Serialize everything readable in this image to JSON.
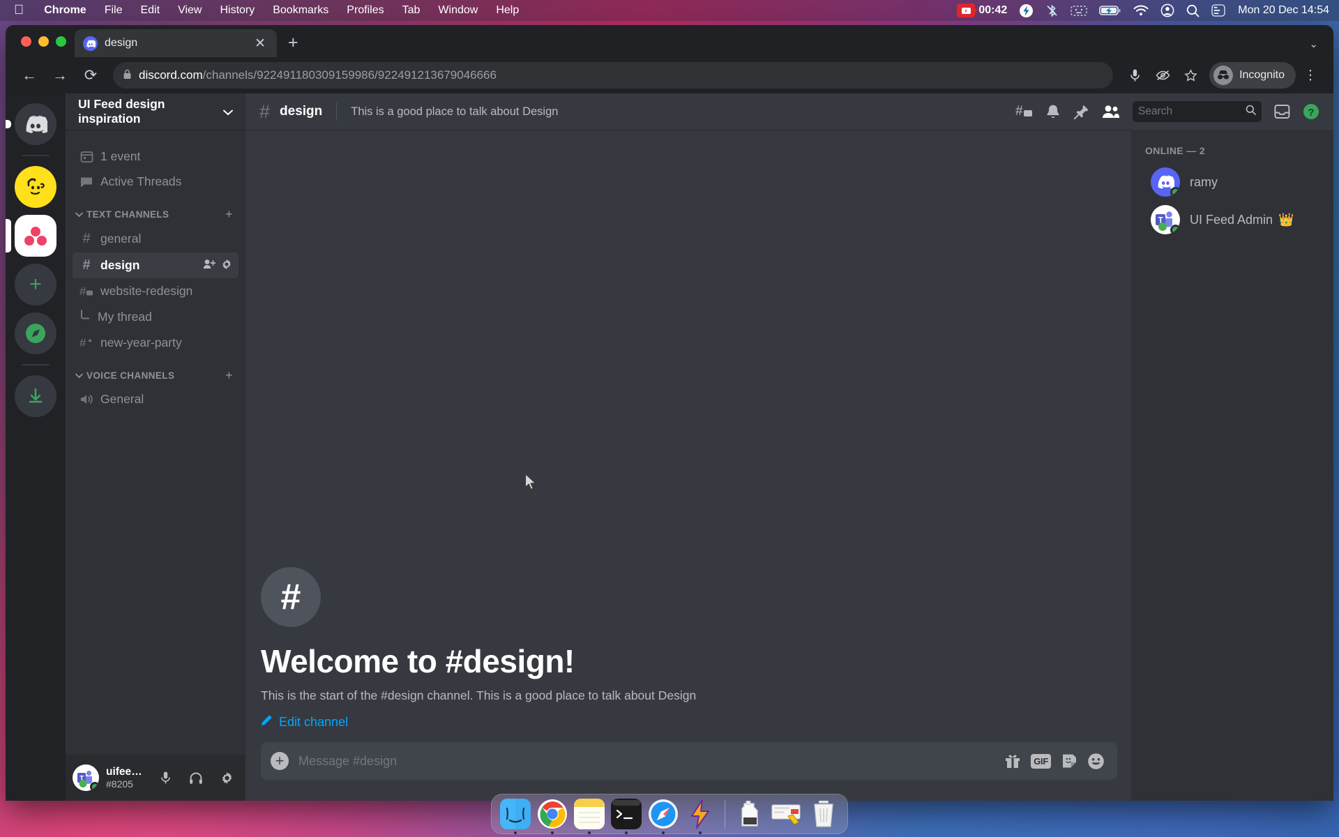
{
  "macos": {
    "menus": [
      "Chrome",
      "File",
      "Edit",
      "View",
      "History",
      "Bookmarks",
      "Profiles",
      "Tab",
      "Window",
      "Help"
    ],
    "app_name": "Chrome",
    "apple_logo": "apple-logo",
    "recording_time": "00:42",
    "clock": "Mon 20 Dec  14:54",
    "status_icons": [
      "lightning-icon",
      "bluetooth-off-icon",
      "keyboard-icon",
      "battery-charging-icon",
      "wifi-icon",
      "account-icon",
      "search-icon",
      "control-center-icon"
    ]
  },
  "browser": {
    "tab": {
      "title": "design",
      "favicon": "discord-icon",
      "close": "✕"
    },
    "new_tab": "+",
    "tab_list_chevron": "⌄",
    "nav": {
      "back": "←",
      "forward": "→",
      "reload": "⟳"
    },
    "url": {
      "lock": "🔒",
      "domain": "discord.com",
      "path": "/channels/922491180309159986/922491213679046666"
    },
    "omni_icons": [
      "microphone-icon",
      "eye-slash-icon",
      "bookmark-star-icon"
    ],
    "profile": {
      "label": "Incognito",
      "icon": "incognito-icon"
    },
    "menu": "⋮"
  },
  "discord": {
    "rail": [
      {
        "name": "discord-home",
        "type": "home"
      },
      {
        "name": "server-mailchimp",
        "type": "mailchimp"
      },
      {
        "name": "server-ui-feed",
        "type": "uifeed",
        "selected": true
      },
      {
        "name": "add-server",
        "type": "plus",
        "symbol": "+"
      },
      {
        "name": "explore-servers",
        "type": "compass"
      },
      {
        "name": "download-apps",
        "type": "download"
      }
    ],
    "guild": {
      "name": "UI Feed design inspiration",
      "chevron": "⌄"
    },
    "sidebar": {
      "top_items": [
        {
          "label": "1 event",
          "icon": "calendar-icon"
        },
        {
          "label": "Active Threads",
          "icon": "threads-icon"
        }
      ],
      "categories": [
        {
          "label": "Text Channels",
          "collapse": "⌄",
          "add": "+",
          "channels": [
            {
              "label": "general",
              "icon": "hash-icon",
              "active": false,
              "thread": false
            },
            {
              "label": "design",
              "icon": "hash-icon",
              "active": true,
              "thread": false,
              "tools": [
                "invite-icon",
                "settings-icon"
              ]
            },
            {
              "label": "website-redesign",
              "icon": "hash-thread-icon",
              "active": false,
              "thread": false
            },
            {
              "label": "My thread",
              "icon": "thread-branch-icon",
              "active": false,
              "thread": true
            },
            {
              "label": "new-year-party",
              "icon": "hash-event-icon",
              "active": false,
              "thread": false
            }
          ]
        },
        {
          "label": "Voice Channels",
          "collapse": "⌄",
          "add": "+",
          "channels": [
            {
              "label": "General",
              "icon": "speaker-icon",
              "active": false,
              "thread": false
            }
          ]
        }
      ]
    },
    "user_panel": {
      "username": "uifeedtestacc",
      "tag": "#8205",
      "avatar": "teams-avatar",
      "controls": [
        "microphone-icon",
        "headphones-icon",
        "settings-gear-icon"
      ]
    },
    "channel_header": {
      "hash": "#",
      "name": "design",
      "topic": "This is a good place to talk about Design",
      "actions": [
        "threads-icon",
        "notification-bell-icon",
        "pinned-messages-icon",
        "member-list-icon"
      ],
      "search_placeholder": "Search",
      "search_icon": "search-icon",
      "inbox_icon": "inbox-icon",
      "help_icon": "help-icon"
    },
    "welcome": {
      "hash": "#",
      "title": "Welcome to #design!",
      "description": "This is the start of the #design channel. This is a good place to talk about Design",
      "edit_label": "Edit channel",
      "edit_icon": "pencil-icon"
    },
    "composer": {
      "placeholder": "Message #design",
      "attach": "+",
      "gift_icon": "gift-icon",
      "gif_label": "GIF",
      "sticker_icon": "sticker-icon",
      "emoji_icon": "emoji-icon"
    },
    "members": {
      "header": "Online — 2",
      "list": [
        {
          "name": "ramy",
          "avatar": "discord-avatar",
          "status": "online",
          "crown": ""
        },
        {
          "name": "UI Feed Admin",
          "avatar": "teams-avatar",
          "status": "online",
          "crown": "👑"
        }
      ]
    }
  },
  "dock": {
    "apps": [
      {
        "name": "finder",
        "running": true
      },
      {
        "name": "chrome",
        "running": true
      },
      {
        "name": "notes",
        "running": true
      },
      {
        "name": "terminal",
        "running": true
      },
      {
        "name": "safari",
        "running": true
      },
      {
        "name": "thunder",
        "running": true
      }
    ],
    "utilities": [
      {
        "name": "jug-file",
        "running": false
      },
      {
        "name": "screenshot-file",
        "running": false
      },
      {
        "name": "trash",
        "running": false
      }
    ]
  }
}
